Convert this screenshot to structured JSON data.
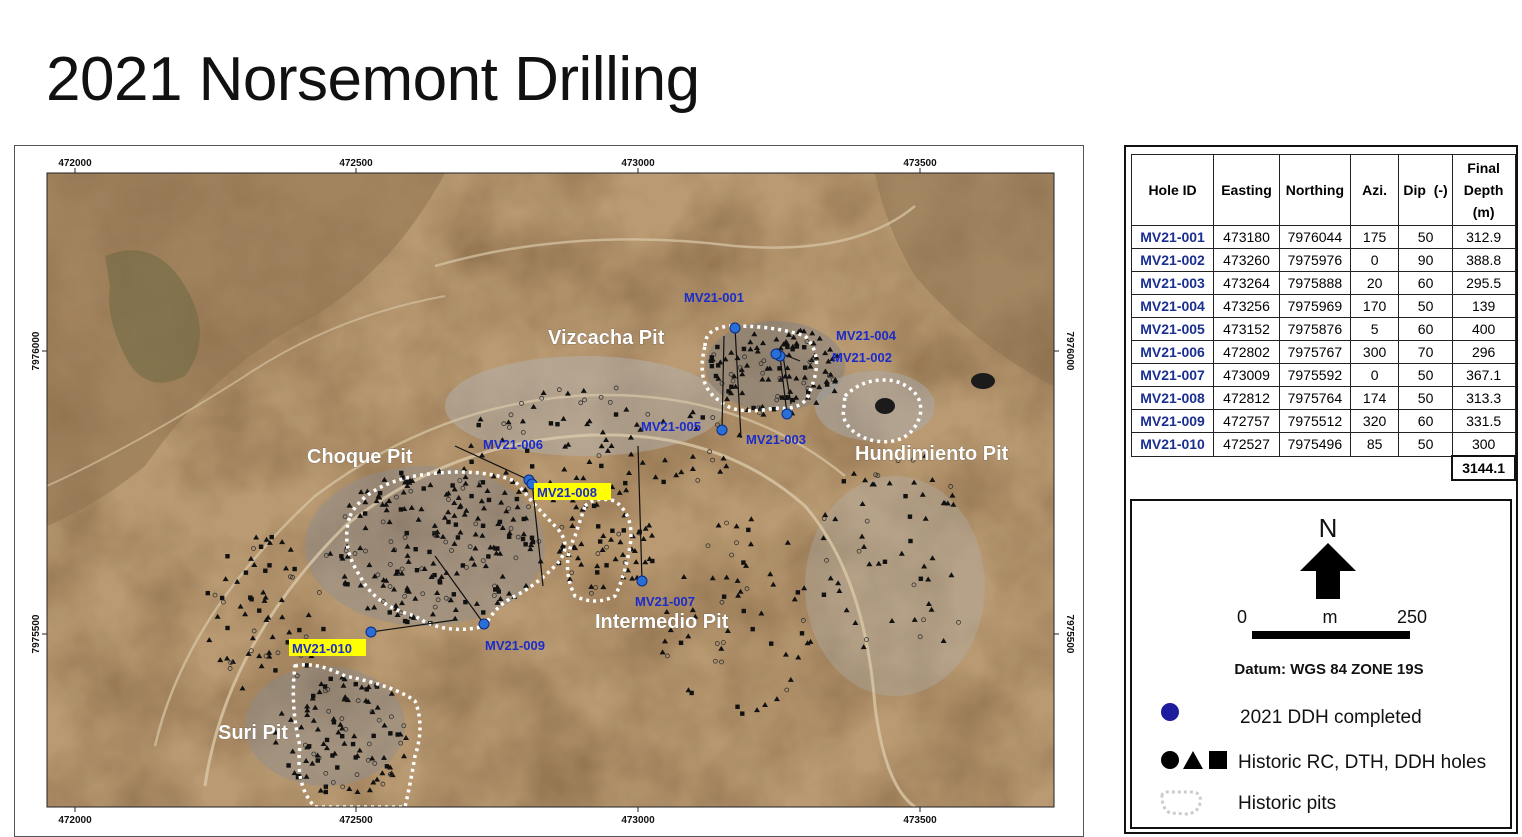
{
  "title": "2021 Norsemont Drilling",
  "map": {
    "top_ticks": [
      "472000",
      "472500",
      "473000",
      "473500"
    ],
    "bottom_ticks": [
      "472000",
      "472500",
      "473000",
      "473500"
    ],
    "left_ticks": [
      "7976000",
      "7975500"
    ],
    "right_ticks": [
      "7976000",
      "7975500"
    ],
    "pits": [
      {
        "name": "Vizcacha Pit"
      },
      {
        "name": "Choque Pit"
      },
      {
        "name": "Hundimiento Pit"
      },
      {
        "name": "Intermedio Pit"
      },
      {
        "name": "Suri Pit"
      }
    ],
    "hole_labels": [
      {
        "id": "MV21-001",
        "highlight": false
      },
      {
        "id": "MV21-004",
        "highlight": false
      },
      {
        "id": "MV21-002",
        "highlight": false
      },
      {
        "id": "MV21-005",
        "highlight": false
      },
      {
        "id": "MV21-003",
        "highlight": false
      },
      {
        "id": "MV21-006",
        "highlight": false
      },
      {
        "id": "MV21-008",
        "highlight": true
      },
      {
        "id": "MV21-007",
        "highlight": false
      },
      {
        "id": "MV21-010",
        "highlight": true
      },
      {
        "id": "MV21-009",
        "highlight": false
      }
    ],
    "colors": {
      "terrain": "#b99a72",
      "pit_outline": "#ffffff",
      "ddh_marker": "#2a6fd6",
      "hole_label": "#1c2cc9",
      "highlight": "#ffff00"
    }
  },
  "table": {
    "headers": [
      "Hole ID",
      "Easting",
      "Northing",
      "Azi.",
      "Dip  (-)",
      "Final Depth (m)"
    ],
    "rows": [
      [
        "MV21-001",
        "473180",
        "7976044",
        "175",
        "50",
        "312.9"
      ],
      [
        "MV21-002",
        "473260",
        "7975976",
        "0",
        "90",
        "388.8"
      ],
      [
        "MV21-003",
        "473264",
        "7975888",
        "20",
        "60",
        "295.5"
      ],
      [
        "MV21-004",
        "473256",
        "7975969",
        "170",
        "50",
        "139"
      ],
      [
        "MV21-005",
        "473152",
        "7975876",
        "5",
        "60",
        "400"
      ],
      [
        "MV21-006",
        "472802",
        "7975767",
        "300",
        "70",
        "296"
      ],
      [
        "MV21-007",
        "473009",
        "7975592",
        "0",
        "50",
        "367.1"
      ],
      [
        "MV21-008",
        "472812",
        "7975764",
        "174",
        "50",
        "313.3"
      ],
      [
        "MV21-009",
        "472757",
        "7975512",
        "320",
        "60",
        "331.5"
      ],
      [
        "MV21-010",
        "472527",
        "7975496",
        "85",
        "50",
        "300"
      ]
    ],
    "total_depth": "3144.1"
  },
  "legend": {
    "north": "N",
    "scale_start": "0",
    "scale_unit": "m",
    "scale_end": "250",
    "datum": "Datum: WGS 84 ZONE 19S",
    "ddh_label": "2021 DDH completed",
    "historic_label": "Historic RC, DTH, DDH holes",
    "pits_label": "Historic pits"
  }
}
